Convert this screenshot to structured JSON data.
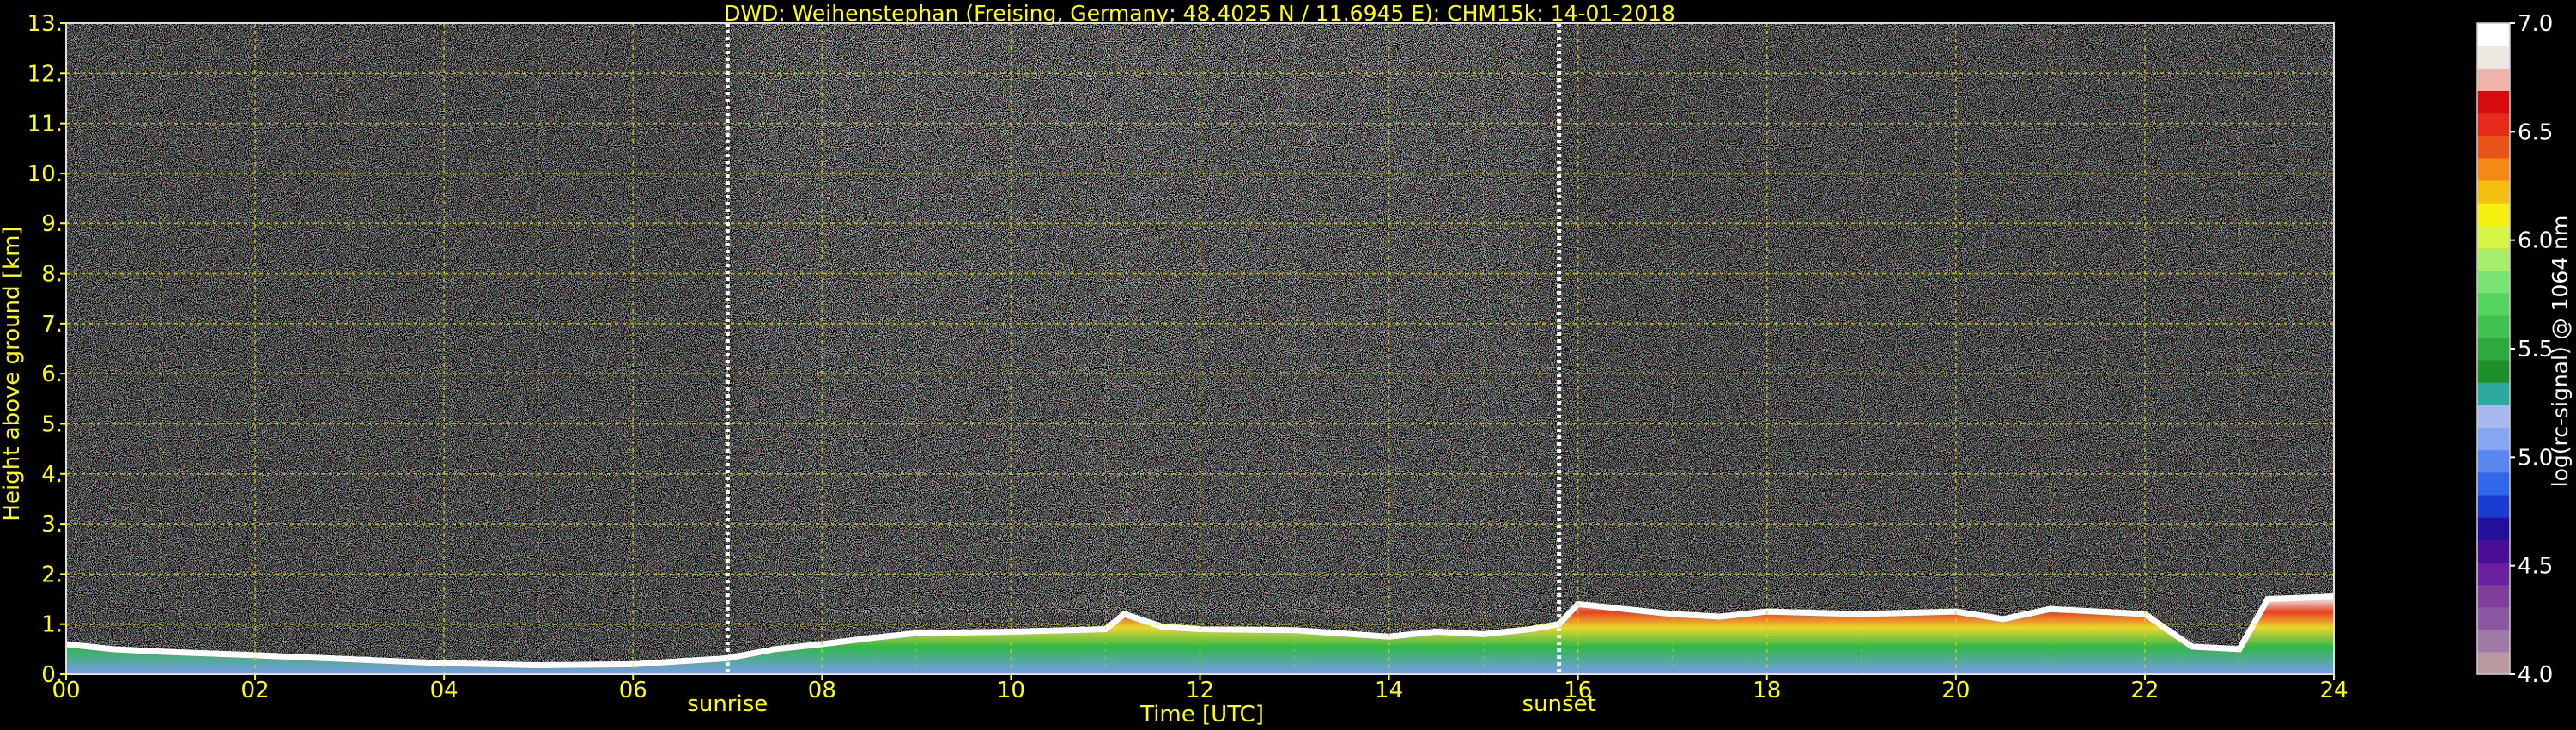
{
  "chart_data": {
    "type": "heatmap",
    "title": "DWD: Weihenstephan (Freising, Germany; 48.4025 N / 11.6945 E):    CHM15k: 14-01-2018",
    "xlabel": "Time [UTC]",
    "ylabel": "Height above ground [km]",
    "xlim": [
      0,
      24
    ],
    "ylim": [
      0,
      13
    ],
    "xticks": [
      "00",
      "02",
      "04",
      "06",
      "08",
      "10",
      "12",
      "14",
      "16",
      "18",
      "20",
      "22",
      "24"
    ],
    "yticks": [
      "0.",
      "1.",
      "2.",
      "3.",
      "4.",
      "5.",
      "6.",
      "7.",
      "8.",
      "9.",
      "10.",
      "11.",
      "12.",
      "13."
    ],
    "grid": true,
    "markers": [
      {
        "label": "sunrise",
        "time": 7.0
      },
      {
        "label": "sunset",
        "time": 15.8
      }
    ],
    "colorbar": {
      "label": "log(rc-signal) @ 1064 nm",
      "range": [
        4.0,
        7.0
      ],
      "ticks": [
        "4.0",
        "4.5",
        "5.0",
        "5.5",
        "6.0",
        "6.5",
        "7.0"
      ],
      "colors": [
        "#b89aa0",
        "#a07aa6",
        "#8a58a0",
        "#7d3f9a",
        "#6a1ea0",
        "#4a0e96",
        "#23109a",
        "#1a3bd0",
        "#2f66ea",
        "#5a86f0",
        "#86a6f2",
        "#a8b9f0",
        "#2aa99c",
        "#1c8f2a",
        "#2fa83e",
        "#3fc24f",
        "#55d460",
        "#7ae472",
        "#a8ee6c",
        "#d8f444",
        "#f4f010",
        "#f4c010",
        "#f48a14",
        "#ea5418",
        "#e82a1c",
        "#d80c0c",
        "#f0b4ac",
        "#eee8e2",
        "#ffffff"
      ]
    },
    "boundary_layer_top_km": {
      "time": [
        0,
        0.5,
        1,
        2,
        3,
        4,
        5,
        6,
        7,
        7.5,
        8,
        8.5,
        9,
        10,
        11,
        11.2,
        11.6,
        12,
        13,
        14,
        14.5,
        15,
        15.5,
        15.8,
        16,
        17,
        17.5,
        18,
        19,
        20,
        20.5,
        21,
        22,
        22.5,
        23,
        23.3,
        24
      ],
      "height": [
        0.6,
        0.5,
        0.45,
        0.38,
        0.3,
        0.22,
        0.18,
        0.2,
        0.32,
        0.5,
        0.6,
        0.72,
        0.82,
        0.85,
        0.9,
        1.2,
        0.95,
        0.9,
        0.88,
        0.75,
        0.85,
        0.8,
        0.9,
        1.0,
        1.4,
        1.2,
        1.15,
        1.25,
        1.2,
        1.25,
        1.1,
        1.3,
        1.2,
        0.55,
        0.5,
        1.5,
        1.55
      ]
    },
    "background_signal": {
      "clear_night_hue": "blue-green fading to purple near ground",
      "daytime_enhanced_range_hours": [
        7.0,
        15.8
      ],
      "daytime_peak_hour": 11.2
    }
  }
}
